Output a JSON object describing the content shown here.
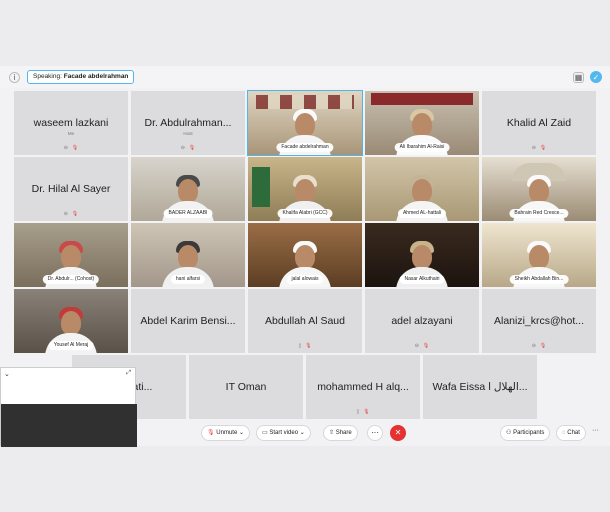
{
  "speaking": {
    "label": "Speaking:",
    "name": "Facade abdelrahman"
  },
  "tiles": [
    {
      "name": "waseem lazkani",
      "sub": "Me"
    },
    {
      "name": "Dr. Abdulrahman...",
      "sub": "Host"
    },
    {
      "name": "Facade abdelrahman"
    },
    {
      "name": "Ali Ibarahim Al-Raisi"
    },
    {
      "name": "Khalid Al Zaid"
    },
    {
      "name": "Dr. Hilal Al Sayer"
    },
    {
      "name": "BADER ALZAABI"
    },
    {
      "name": "Khalifa Alabri (GCC)"
    },
    {
      "name": "Ahmed AL-hattali"
    },
    {
      "name": "Bahrain Red Cresce..."
    },
    {
      "name": "Dr. Abdulr...",
      "tag": "(Cohost)"
    },
    {
      "name": "hani alfarsi"
    },
    {
      "name": "jalal alowais"
    },
    {
      "name": "Nasar Alkuthairi"
    },
    {
      "name": "Sheikh Abdallah Bin..."
    },
    {
      "name": "Yousef Al Meraj"
    },
    {
      "name": "Abdel Karim Bensi..."
    },
    {
      "name": "Abdullah Al Saud"
    },
    {
      "name": "adel alzayani"
    },
    {
      "name": "Alanizi_krcs@hot..."
    },
    {
      "name": "al Relati..."
    },
    {
      "name": "IT Oman"
    },
    {
      "name": "mohammed H alq..."
    },
    {
      "name": "Wafa Eissa الهلال ا..."
    }
  ],
  "toolbar": {
    "unmute": "Unmute",
    "start_video": "Start video",
    "share": "Share",
    "more": "···",
    "end": "✕",
    "participants": "Participants",
    "chat": "Chat"
  },
  "colors": {
    "accent": "#51b9f0",
    "end": "#e5312f"
  }
}
